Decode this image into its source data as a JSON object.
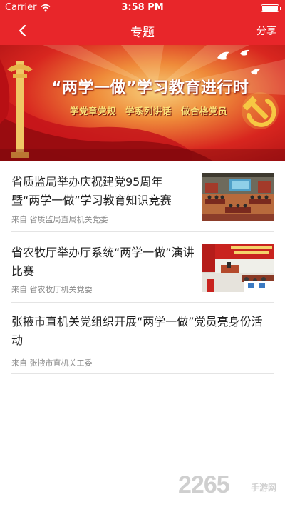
{
  "status_bar": {
    "carrier": "Carrier",
    "time": "3:58 PM"
  },
  "nav": {
    "title": "专题",
    "share_label": "分享"
  },
  "banner": {
    "title": "“两学一做”学习教育进行时",
    "subtitle": "学党章党规　学系列讲话　做合格党员"
  },
  "news": [
    {
      "title": "省质监局举办庆祝建党95周年暨“两学一做”学习教育知识竞赛",
      "source": "来自 省质监局直属机关党委",
      "has_thumbnail": true
    },
    {
      "title": "省农牧厅举办厅系统“两学一做”演讲比赛",
      "source": "来自 省农牧厅机关党委",
      "has_thumbnail": true
    },
    {
      "title": "张掖市直机关党组织开展“两学一做”党员亮身份活动",
      "source": "来自 张掖市直机关工委",
      "has_thumbnail": false
    }
  ],
  "watermark": {
    "text": "2265",
    "sub": "手游网"
  },
  "colors": {
    "brand_red": "#e8262a",
    "title_text": "#222222",
    "source_text": "#8a8a8a",
    "divider": "#e4e4e4"
  }
}
